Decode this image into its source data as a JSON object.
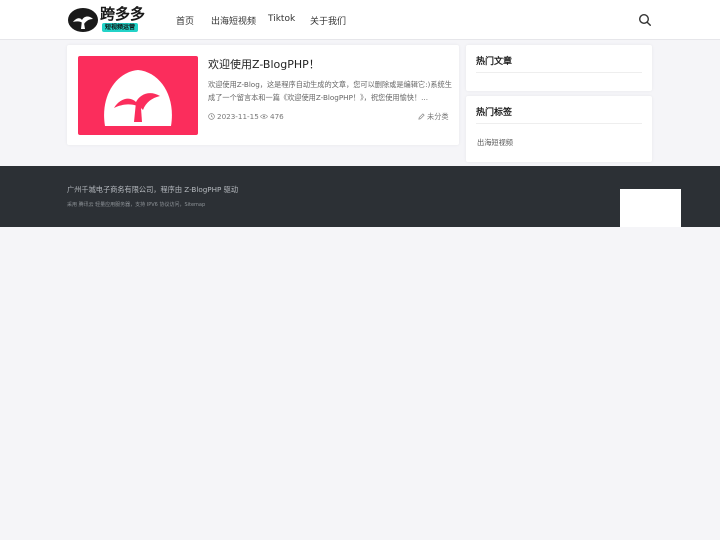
{
  "header": {
    "logo": {
      "brand": "跨多多",
      "tagline": "短视频运营"
    },
    "nav": [
      {
        "label": "首页"
      },
      {
        "label": "出海短视频"
      },
      {
        "label": "Tiktok"
      },
      {
        "label": "关于我们"
      }
    ]
  },
  "post": {
    "title": "欢迎使用Z-BlogPHP！",
    "excerpt": "欢迎使用Z-Blog，这是程序自动生成的文章，您可以删除或是编辑它:)系统生成了一个留言本和一篇《欢迎使用Z-BlogPHP！》，祝您使用愉快！...",
    "date": "2023-11-15",
    "views": "476",
    "category": "未分类"
  },
  "sidebar": {
    "hot_articles_title": "热门文章",
    "hot_tags_title": "热门标签",
    "tags": [
      "出海短视频"
    ]
  },
  "footer": {
    "copyright": "广州千城电子商务有限公司，程序由 Z-BlogPHP 驱动",
    "hosting": "采用 腾讯云 轻量应用服务器，支持 IPV6 协议访问，Sitemap"
  },
  "colors": {
    "accent": "#fb2d5c",
    "tagline_bg": "#23d3c8",
    "footer_bg": "#2c3035"
  }
}
